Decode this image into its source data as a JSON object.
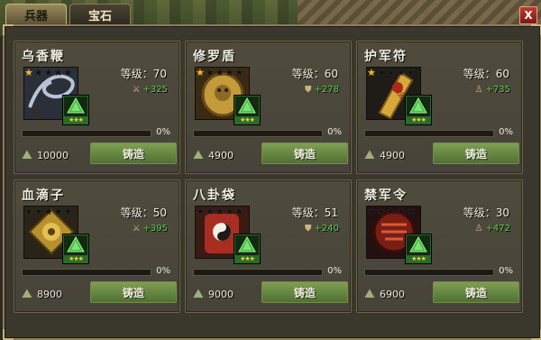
{
  "tabs": [
    {
      "label": "兵器",
      "active": true
    },
    {
      "label": "宝石",
      "active": false
    }
  ],
  "close_label": "X",
  "pct_label": "0%",
  "forge_label": "铸造",
  "items": [
    {
      "name": "乌香鞭",
      "stars": 1,
      "level_label": "等级：70",
      "attr_icon": "sword-icon",
      "attr_glyph": "⚔",
      "attr_value": "+325",
      "progress": 0,
      "cost": "10000",
      "art": "whip"
    },
    {
      "name": "修罗盾",
      "stars": 1,
      "level_label": "等级：60",
      "attr_icon": "shield-icon",
      "attr_glyph": "⛊",
      "attr_value": "+278",
      "progress": 0,
      "cost": "4900",
      "art": "shield"
    },
    {
      "name": "护军符",
      "stars": 1,
      "level_label": "等级：60",
      "attr_icon": "person-icon",
      "attr_glyph": "♙",
      "attr_value": "+735",
      "progress": 0,
      "cost": "4900",
      "art": "talisman"
    },
    {
      "name": "血滴子",
      "stars": 0,
      "level_label": "等级：50",
      "attr_icon": "sword-icon",
      "attr_glyph": "⚔",
      "attr_value": "+395",
      "progress": 0,
      "cost": "8900",
      "art": "disc"
    },
    {
      "name": "八卦袋",
      "stars": 0,
      "level_label": "等级：51",
      "attr_icon": "shield-icon",
      "attr_glyph": "⛊",
      "attr_value": "+240",
      "progress": 0,
      "cost": "9000",
      "art": "bagua"
    },
    {
      "name": "禁军令",
      "stars": 0,
      "level_label": "等级：30",
      "attr_icon": "person-icon",
      "attr_glyph": "♙",
      "attr_value": "+472",
      "progress": 0,
      "cost": "6900",
      "art": "token"
    }
  ]
}
